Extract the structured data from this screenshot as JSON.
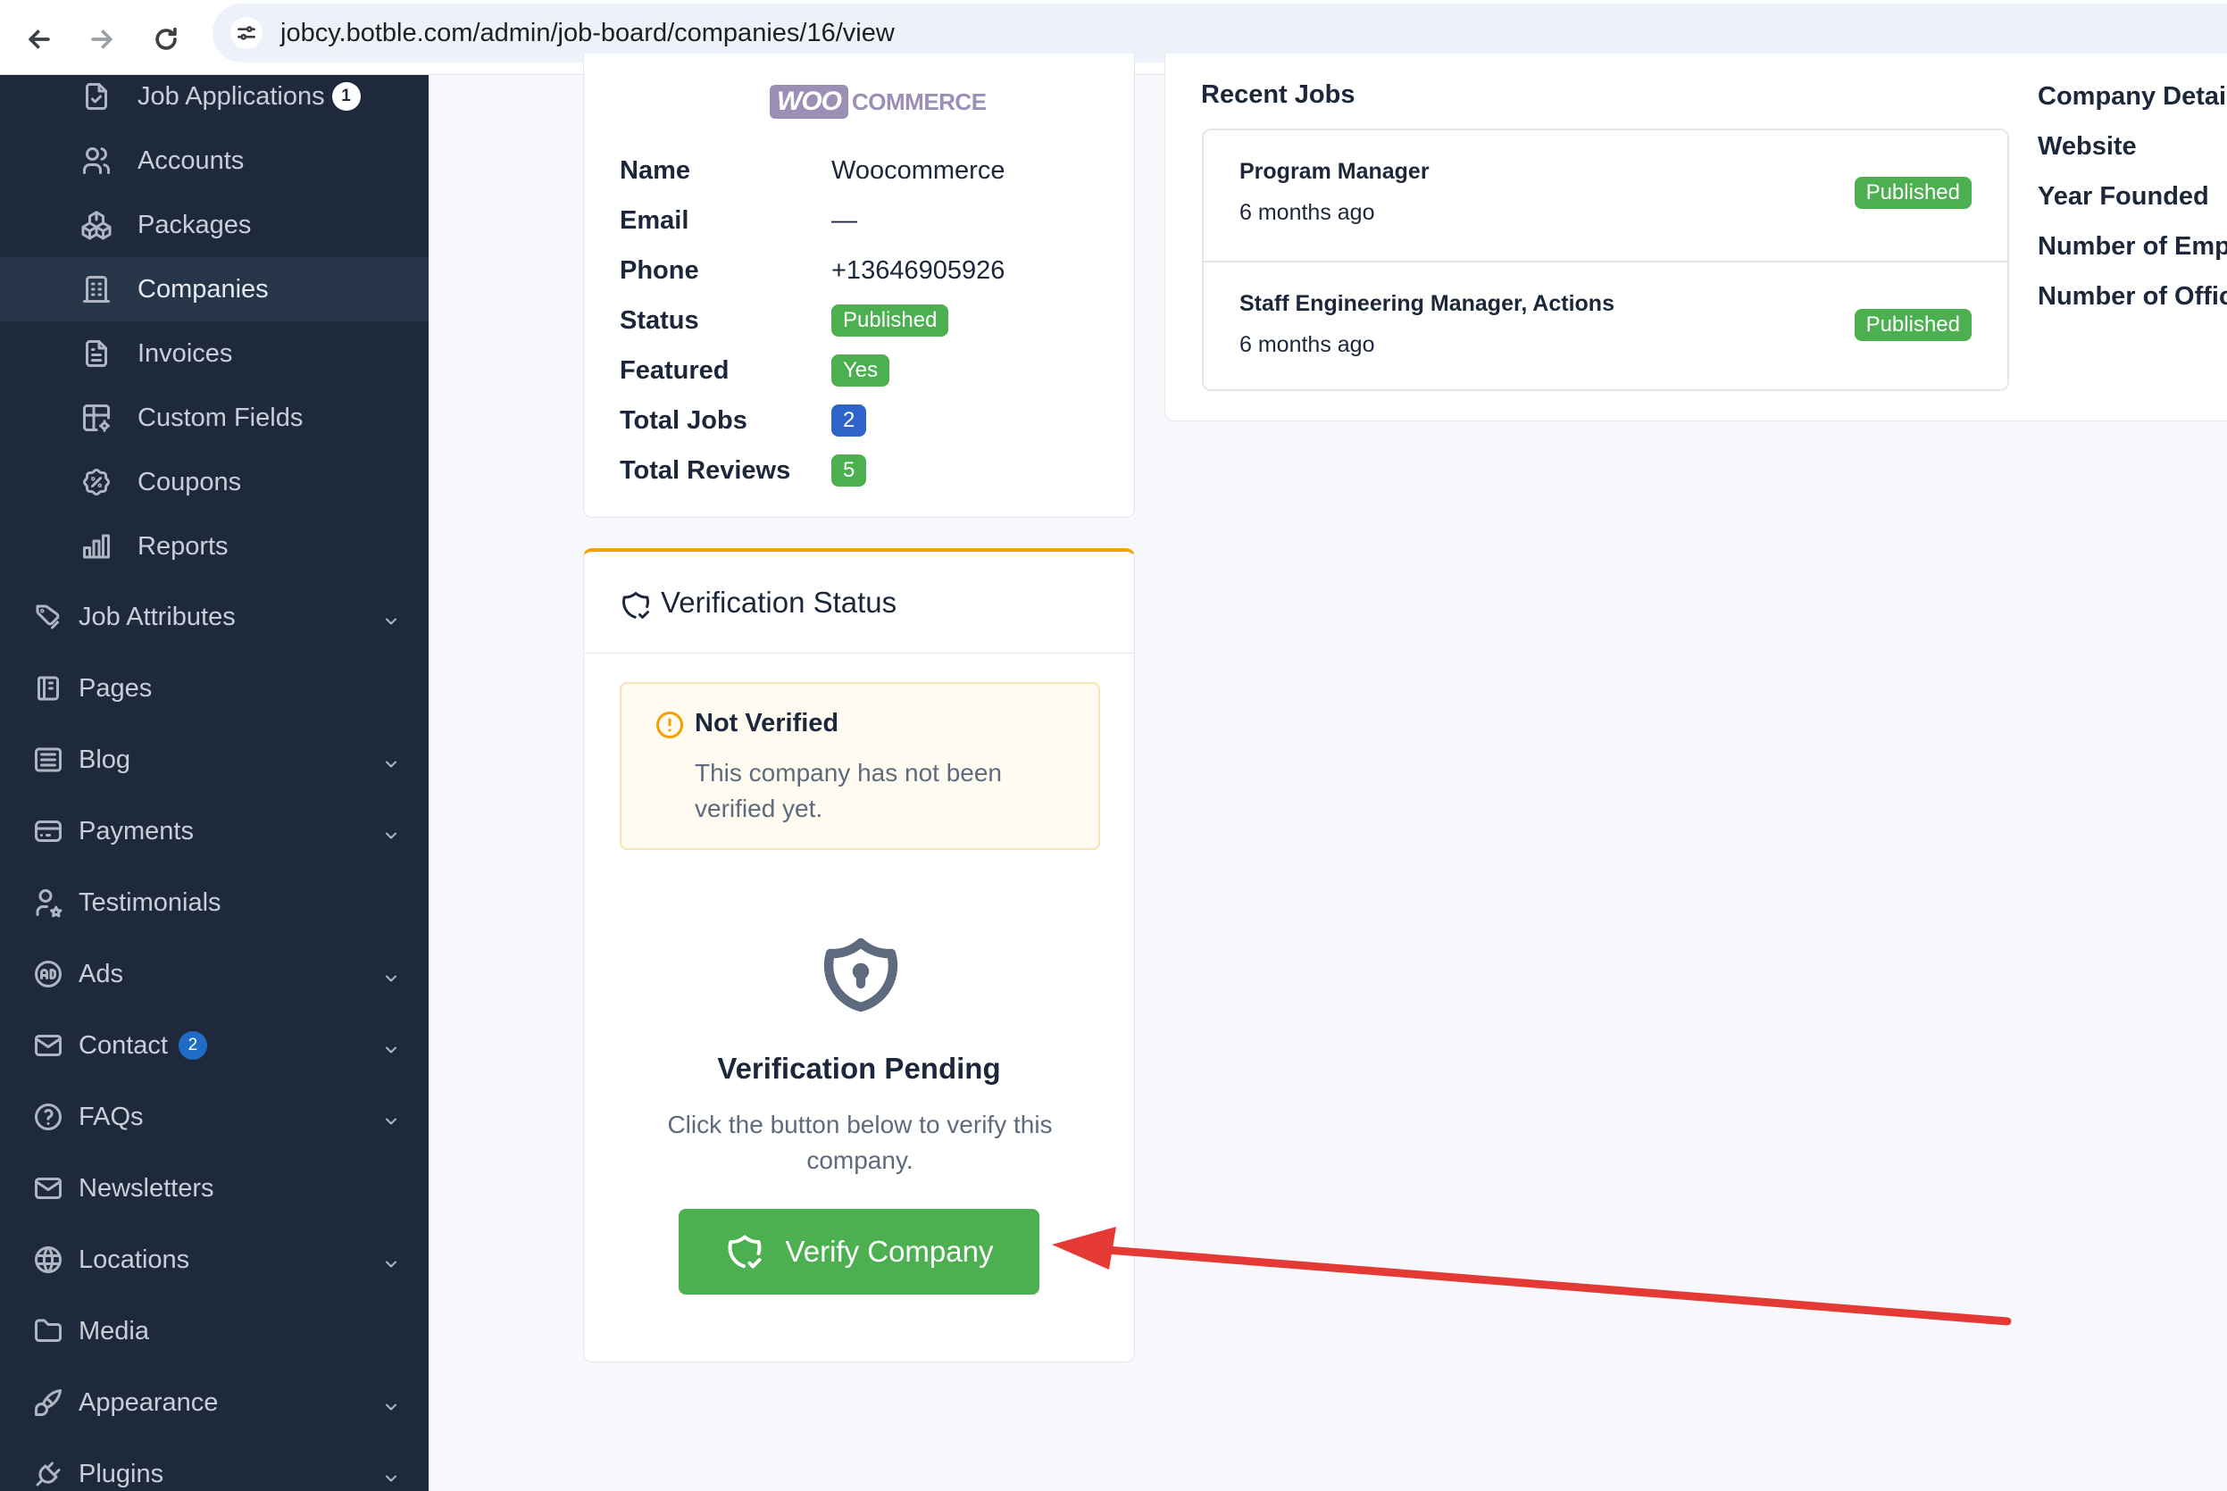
{
  "browser": {
    "url": "jobcy.botble.com/admin/job-board/companies/16/view"
  },
  "sidebar": {
    "sub_items": [
      {
        "label": "Job Applications",
        "icon": "file-check-icon",
        "badge": "1"
      },
      {
        "label": "Accounts",
        "icon": "users-icon"
      },
      {
        "label": "Packages",
        "icon": "packages-icon"
      },
      {
        "label": "Companies",
        "icon": "building-icon",
        "active": true
      },
      {
        "label": "Invoices",
        "icon": "file-invoice-icon"
      },
      {
        "label": "Custom Fields",
        "icon": "table-settings-icon"
      },
      {
        "label": "Coupons",
        "icon": "discount-icon"
      },
      {
        "label": "Reports",
        "icon": "chart-bar-icon"
      }
    ],
    "items": [
      {
        "label": "Job Attributes",
        "icon": "tags-icon",
        "expandable": true
      },
      {
        "label": "Pages",
        "icon": "notebook-icon"
      },
      {
        "label": "Blog",
        "icon": "article-icon",
        "expandable": true
      },
      {
        "label": "Payments",
        "icon": "credit-card-icon",
        "expandable": true
      },
      {
        "label": "Testimonials",
        "icon": "user-star-icon"
      },
      {
        "label": "Ads",
        "icon": "ad-circle-icon",
        "expandable": true
      },
      {
        "label": "Contact",
        "icon": "mail-icon",
        "expandable": true,
        "badge": "2"
      },
      {
        "label": "FAQs",
        "icon": "help-circle-icon",
        "expandable": true
      },
      {
        "label": "Newsletters",
        "icon": "mail-icon"
      },
      {
        "label": "Locations",
        "icon": "world-icon",
        "expandable": true
      },
      {
        "label": "Media",
        "icon": "folder-icon"
      },
      {
        "label": "Appearance",
        "icon": "brush-icon",
        "expandable": true
      },
      {
        "label": "Plugins",
        "icon": "plug-icon",
        "expandable": true
      }
    ]
  },
  "company": {
    "logo_woo": "WOO",
    "logo_commerce": "COMMERCE",
    "fields": [
      {
        "label": "Name",
        "value": "Woocommerce"
      },
      {
        "label": "Email",
        "value": "—"
      },
      {
        "label": "Phone",
        "value": "+13646905926"
      },
      {
        "label": "Status",
        "value": "Published",
        "pill": "green"
      },
      {
        "label": "Featured",
        "value": "Yes",
        "pill": "green"
      },
      {
        "label": "Total Jobs",
        "value": "2",
        "pill": "blue"
      },
      {
        "label": "Total Reviews",
        "value": "5",
        "pill": "green"
      }
    ]
  },
  "verification": {
    "title": "Verification Status",
    "alert_title": "Not Verified",
    "alert_text": "This company has not been verified yet.",
    "pending_title": "Verification Pending",
    "pending_text": "Click the button below to verify this company.",
    "button_label": "Verify Company"
  },
  "recent_jobs": {
    "heading": "Recent Jobs",
    "jobs": [
      {
        "title": "Program Manager",
        "time": "6 months ago",
        "status": "Published"
      },
      {
        "title": "Staff Engineering Manager, Actions",
        "time": "6 months ago",
        "status": "Published"
      }
    ]
  },
  "company_details": {
    "heading": "Company Detail",
    "labels": [
      "Website",
      "Year Founded",
      "Number of Empl",
      "Number of Offic"
    ]
  },
  "colors": {
    "sidebar_bg": "#1e293b",
    "success": "#4caf50",
    "primary": "#2e63c9",
    "warning": "#f59f00",
    "annotation_arrow": "#e53935"
  }
}
